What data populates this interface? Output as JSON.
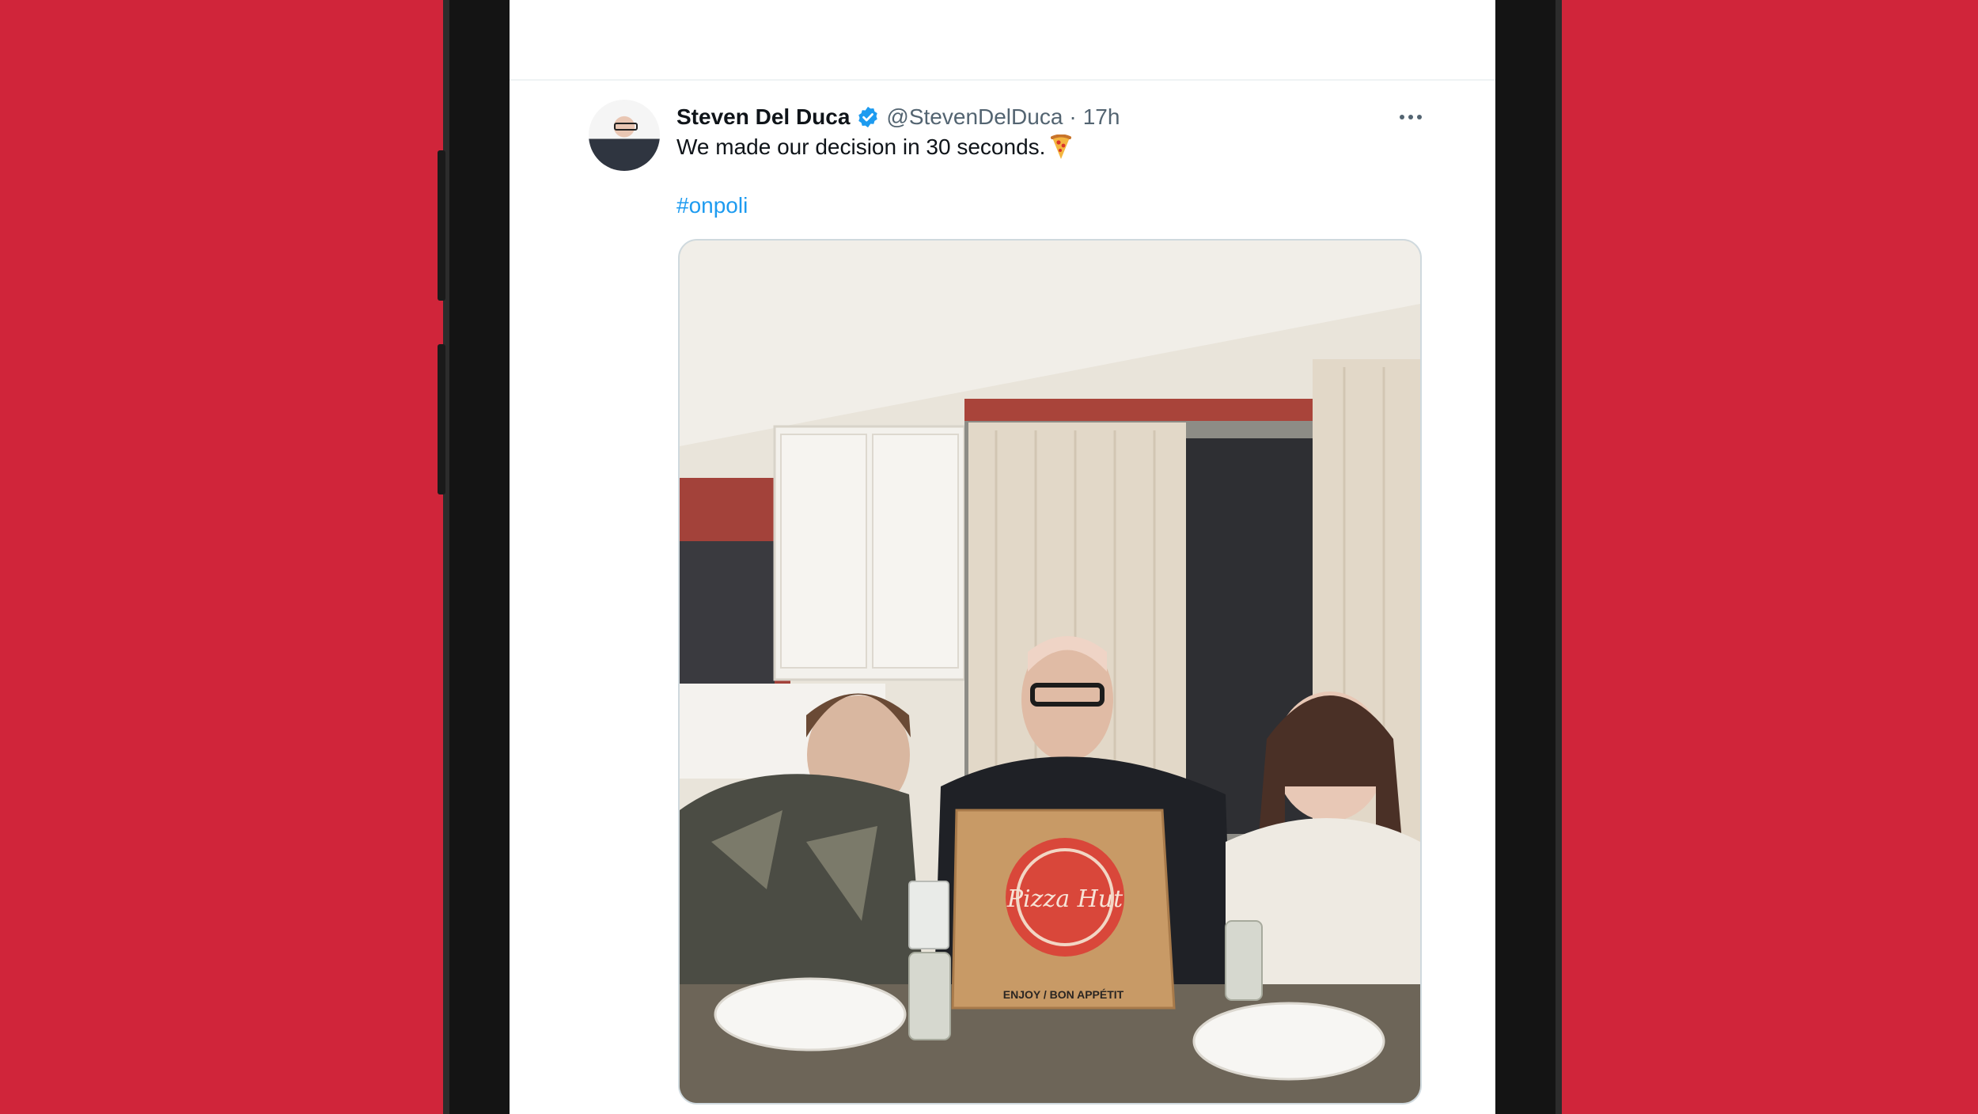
{
  "tweet": {
    "display_name": "Steven Del Duca",
    "handle": "@StevenDelDuca",
    "separator": "·",
    "timestamp": "17h",
    "text": "We made our decision in 30 seconds.",
    "hashtag": "#onpoli",
    "emoji_icon": "pizza-icon",
    "verified_icon": "verified-badge-icon",
    "more_icon": "more-options-icon"
  },
  "photo": {
    "box_brand": "Pizza Hut",
    "box_caption": "ENJOY / BON APPÉTIT"
  },
  "colors": {
    "background": "#d0253a",
    "link": "#1d9bf0",
    "text_primary": "#0f1419",
    "text_secondary": "#536471",
    "pizza_box_logo": "#d9473a"
  }
}
